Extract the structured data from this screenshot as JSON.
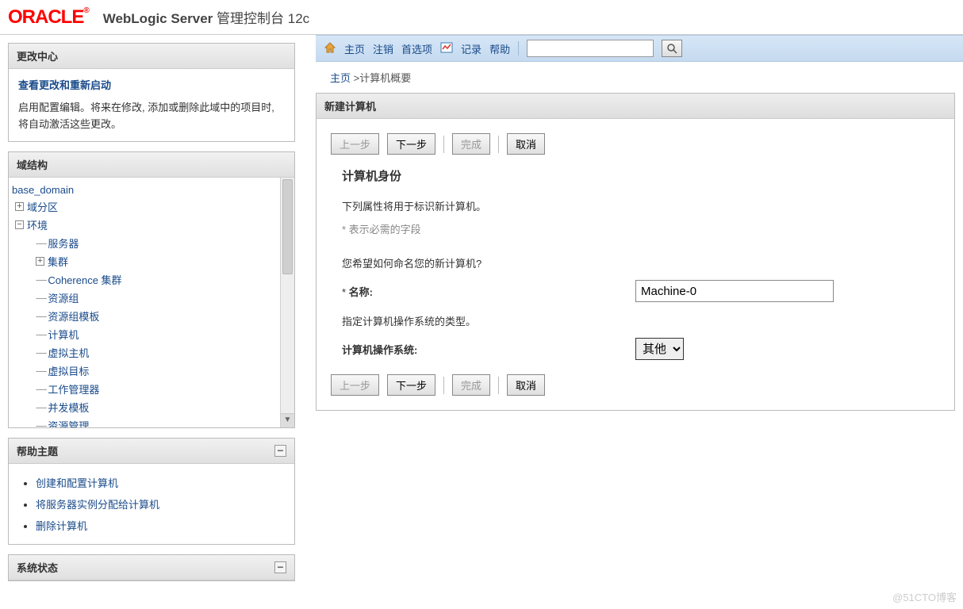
{
  "header": {
    "brand": "ORACLE",
    "app_title_bold": "WebLogic Server",
    "app_title_rest": "管理控制台 12c"
  },
  "toolbar": {
    "home": "主页",
    "logout": "注销",
    "prefs": "首选项",
    "record": "记录",
    "help": "帮助"
  },
  "breadcrumbs": {
    "home": "主页",
    "sep": ">",
    "current": "计算机概要"
  },
  "change_center": {
    "title": "更改中心",
    "link": "查看更改和重新启动",
    "text": "启用配置编辑。将来在修改, 添加或删除此域中的项目时, 将自动激活这些更改。"
  },
  "domain_struct": {
    "title": "域结构",
    "root": "base_domain",
    "items": [
      {
        "label": "域分区",
        "children": [],
        "expandable": true,
        "open": false,
        "depth": 1
      },
      {
        "label": "环境",
        "children": [
          {
            "label": "服务器"
          },
          {
            "label": "集群",
            "expandable": true,
            "open": false
          },
          {
            "label": "Coherence 集群"
          },
          {
            "label": "资源组"
          },
          {
            "label": "资源组模板"
          },
          {
            "label": "计算机"
          },
          {
            "label": "虚拟主机"
          },
          {
            "label": "虚拟目标"
          },
          {
            "label": "工作管理器"
          },
          {
            "label": "并发模板"
          },
          {
            "label": "资源管理"
          }
        ],
        "expandable": true,
        "open": true,
        "depth": 1
      }
    ]
  },
  "help": {
    "title": "帮助主题",
    "items": [
      "创建和配置计算机",
      "将服务器实例分配给计算机",
      "删除计算机"
    ]
  },
  "status": {
    "title": "系统状态"
  },
  "content": {
    "panel_title": "新建计算机",
    "buttons": {
      "back": "上一步",
      "next": "下一步",
      "finish": "完成",
      "cancel": "取消"
    },
    "section_title": "计算机身份",
    "section_desc": "下列属性将用于标识新计算机。",
    "required_note": "* 表示必需的字段",
    "name_prompt": "您希望如何命名您的新计算机?",
    "name_label": "名称:",
    "name_value": "Machine-0",
    "os_prompt": "指定计算机操作系统的类型。",
    "os_label": "计算机操作系统:",
    "os_value": "其他"
  },
  "watermark": "@51CTO博客"
}
